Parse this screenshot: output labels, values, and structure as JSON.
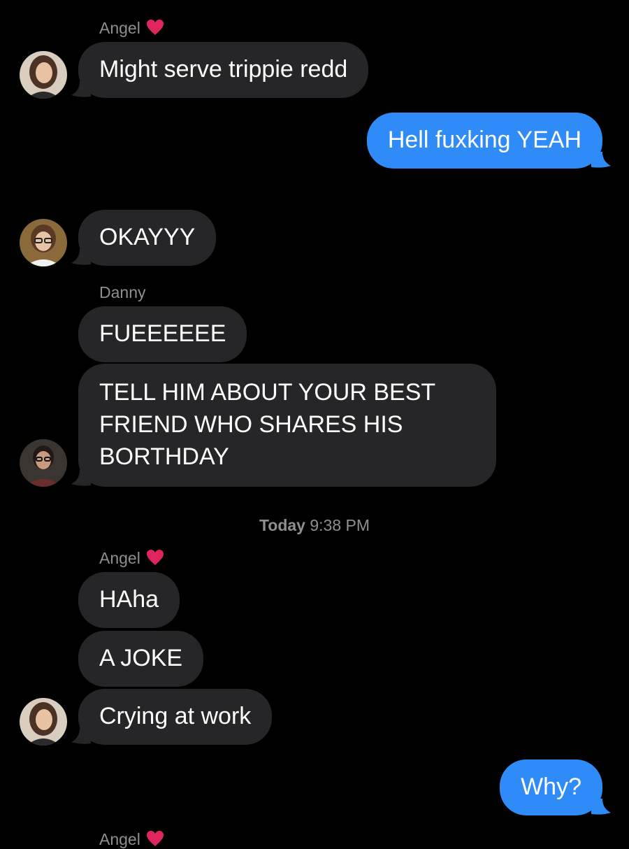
{
  "conversation": {
    "messages": [
      {
        "id": "m1",
        "sender_label": "Angel",
        "text": "Might serve trippie redd"
      },
      {
        "id": "m2",
        "direction": "outgoing",
        "text": "Hell fuxking YEAH"
      },
      {
        "id": "m3",
        "text": "OKAYYY"
      },
      {
        "id": "m4",
        "sender_label": "Danny",
        "text": "FUEEEEEE"
      },
      {
        "id": "m5",
        "text_lines": [
          "TELL HIM ABOUT YOUR BEST",
          "FRIEND WHO SHARES HIS",
          "BORTHDAY"
        ]
      },
      {
        "id": "m6",
        "sender_label": "Angel",
        "text": "HAha"
      },
      {
        "id": "m7",
        "text": "A JOKE"
      },
      {
        "id": "m8",
        "text": "Crying at work"
      },
      {
        "id": "m9",
        "direction": "outgoing",
        "text": "Why?"
      }
    ],
    "timestamp": {
      "day": "Today",
      "time": "9:38 PM"
    },
    "next_sender_label": "Angel"
  },
  "colors": {
    "background": "#000000",
    "incoming_bubble": "#262628",
    "outgoing_bubble": "#2f8bf7",
    "secondary_text": "#8e8e93",
    "heart": "#e0245e"
  },
  "icons": {
    "heart": "red-heart-emoji"
  }
}
